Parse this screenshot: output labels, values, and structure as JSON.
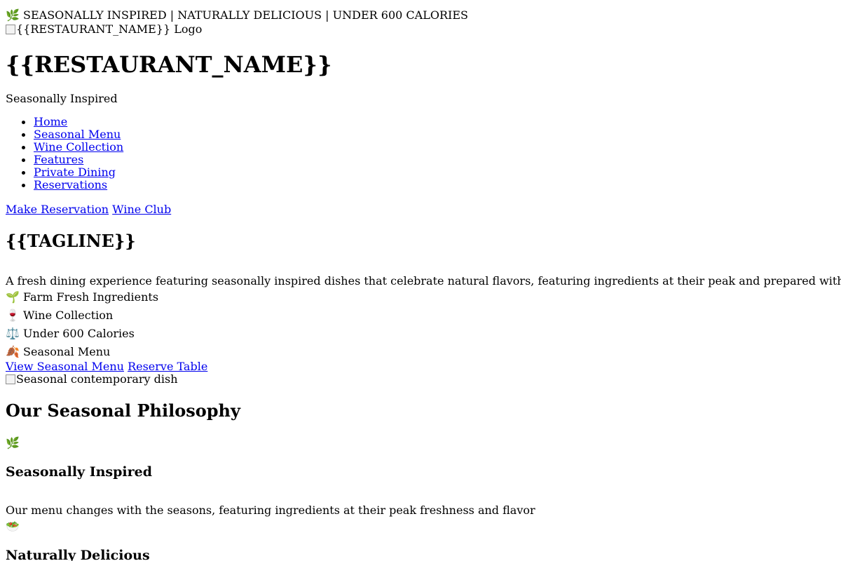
{
  "announcement": {
    "icon": "leaf-icon",
    "glyph": "🌿",
    "text": "SEASONALLY INSPIRED | NATURALLY DELICIOUS | UNDER 600 CALORIES"
  },
  "header": {
    "logo_alt": "{{RESTAURANT_NAME}} Logo",
    "restaurant_name": "{{RESTAURANT_NAME}}",
    "subtitle": "Seasonally Inspired"
  },
  "nav": {
    "items": [
      {
        "label": "Home"
      },
      {
        "label": "Seasonal Menu"
      },
      {
        "label": "Wine Collection"
      },
      {
        "label": "Features"
      },
      {
        "label": "Private Dining"
      },
      {
        "label": "Reservations"
      }
    ]
  },
  "header_actions": {
    "reservation_label": "Make Reservation",
    "wine_club_label": "Wine Club"
  },
  "hero": {
    "tagline": "{{TAGLINE}}",
    "description": "A fresh dining experience featuring seasonally inspired dishes that celebrate natural flavors, featuring ingredients at their peak and prepared with modern culinary techniques.",
    "features": [
      {
        "icon": "seedling-icon",
        "glyph": "🌱",
        "label": "Farm Fresh Ingredients"
      },
      {
        "icon": "wine-glass-icon",
        "glyph": "🍷",
        "label": "Wine Collection"
      },
      {
        "icon": "scale-icon",
        "glyph": "⚖️",
        "label": "Under 600 Calories"
      },
      {
        "icon": "autumn-leaves-icon",
        "glyph": "🍂",
        "label": "Seasonal Menu"
      }
    ],
    "view_menu_label": "View Seasonal Menu",
    "reserve_label": "Reserve Table",
    "image_alt": "Seasonal contemporary dish"
  },
  "philosophy": {
    "title": "Our Seasonal Philosophy",
    "items": [
      {
        "icon": "leaf-icon",
        "glyph": "🌿",
        "title": "Seasonally Inspired",
        "text": "Our menu changes with the seasons, featuring ingredients at their peak freshness and flavor"
      },
      {
        "icon": "salad-icon",
        "glyph": "🥗",
        "title": "Naturally Delicious"
      }
    ]
  }
}
